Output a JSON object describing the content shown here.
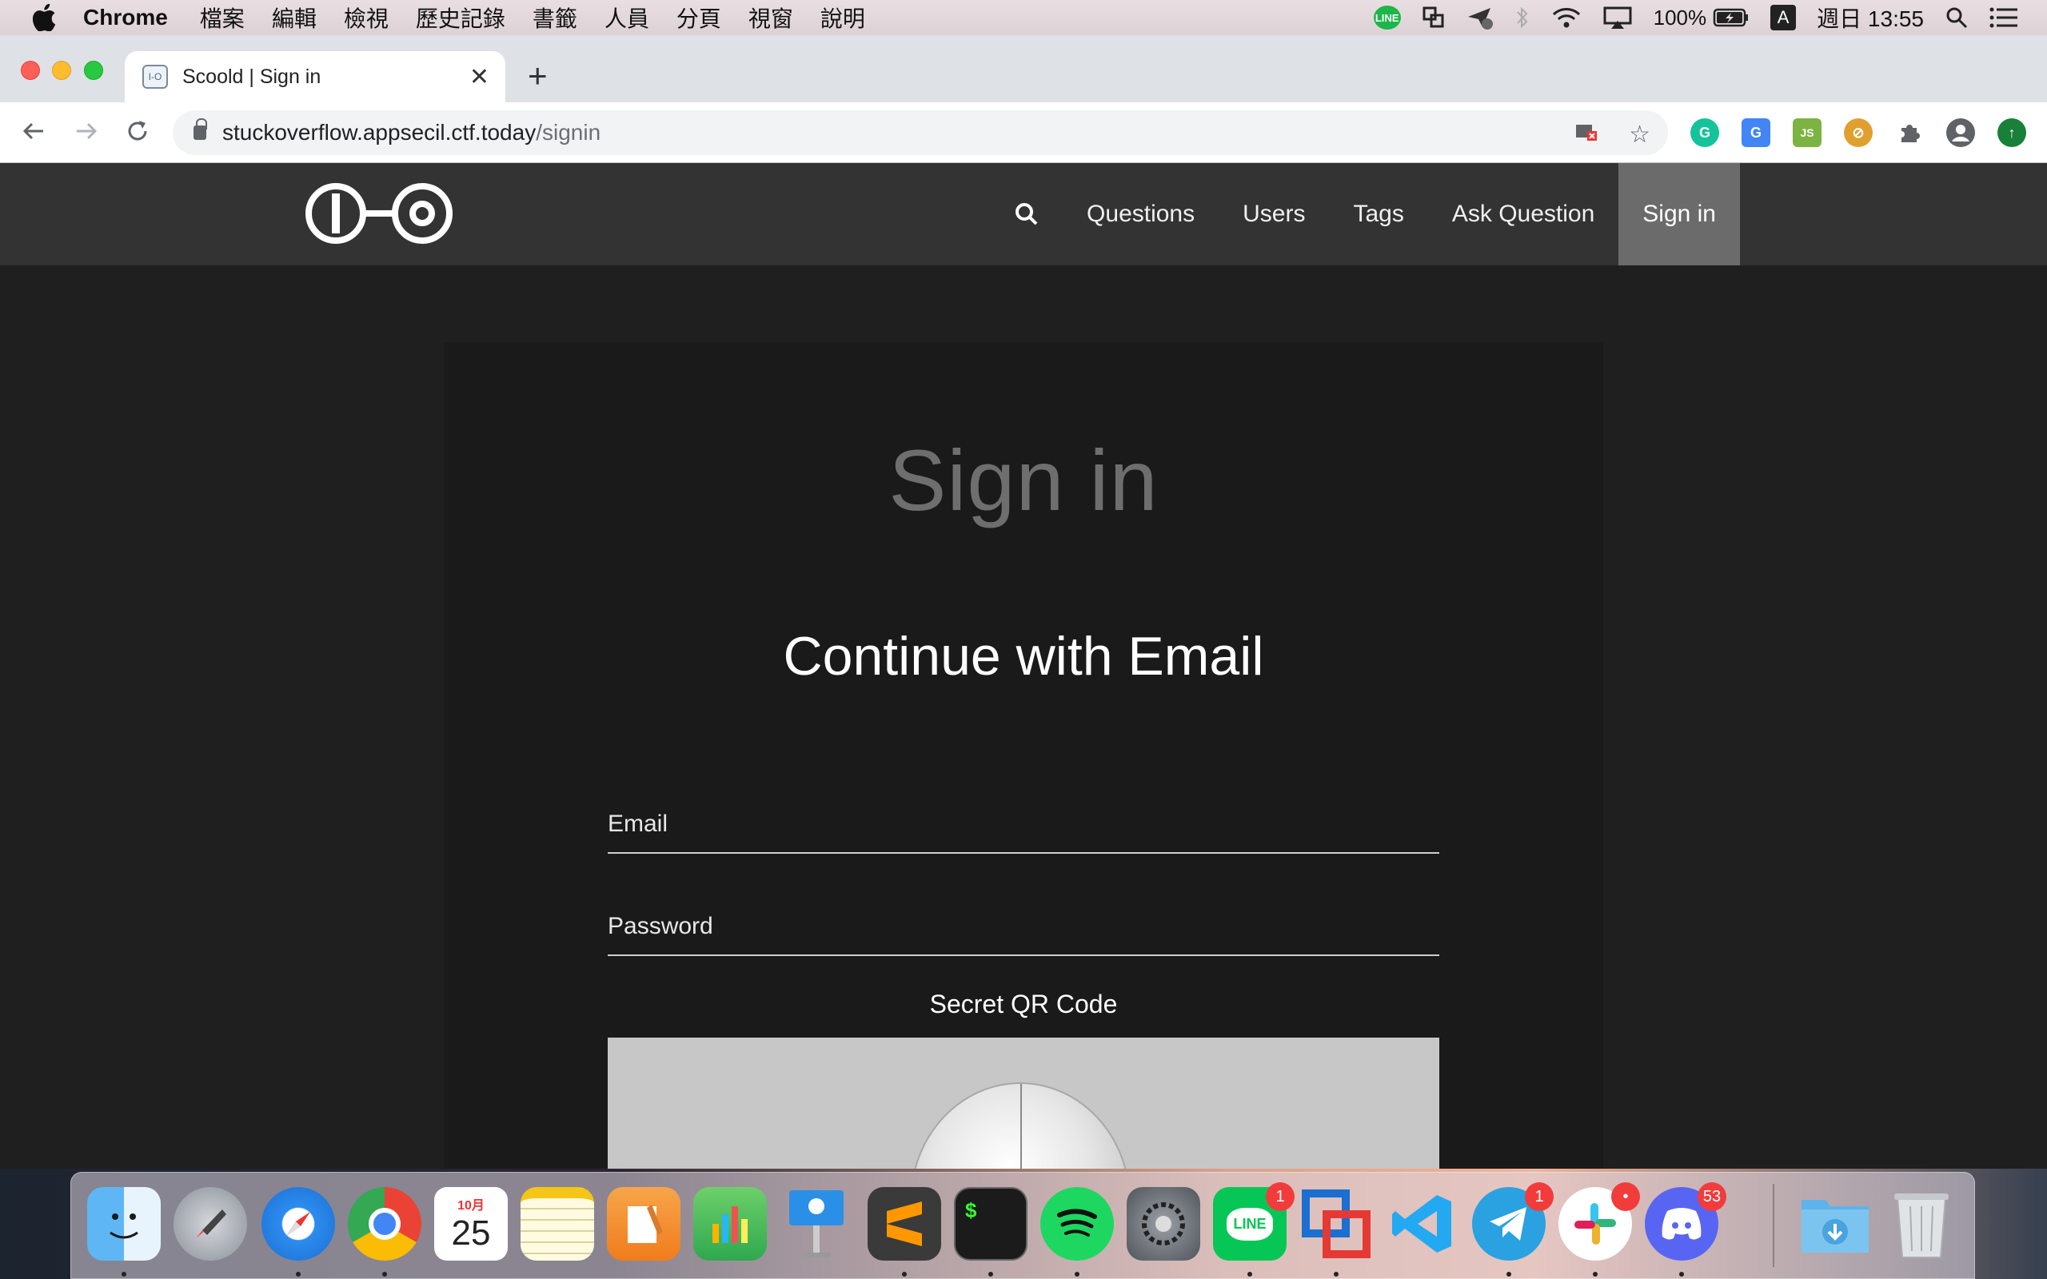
{
  "menubar": {
    "app": "Chrome",
    "items": [
      "檔案",
      "編輯",
      "檢視",
      "歷史記錄",
      "書籤",
      "人員",
      "分頁",
      "視窗",
      "說明"
    ],
    "line_label": "LINE",
    "battery": "100%",
    "input_source": "A",
    "clock": "週日 13:55"
  },
  "browser": {
    "tab_title": "Scoold | Sign in",
    "url_host": "stuckoverflow.appsecil.ctf.today",
    "url_path": "/signin"
  },
  "site": {
    "nav": {
      "questions": "Questions",
      "users": "Users",
      "tags": "Tags",
      "ask": "Ask Question",
      "signin": "Sign in"
    },
    "heading": "Sign in",
    "subheading": "Continue with Email",
    "email_label": "Email",
    "password_label": "Password",
    "secret_label": "Secret QR Code"
  },
  "dock": {
    "calendar_month": "10月",
    "calendar_day": "25",
    "line_label": "LINE",
    "terminal_prompt": "$",
    "badges": {
      "line": "1",
      "telegram": "1",
      "slack": "•",
      "discord": "53"
    }
  }
}
